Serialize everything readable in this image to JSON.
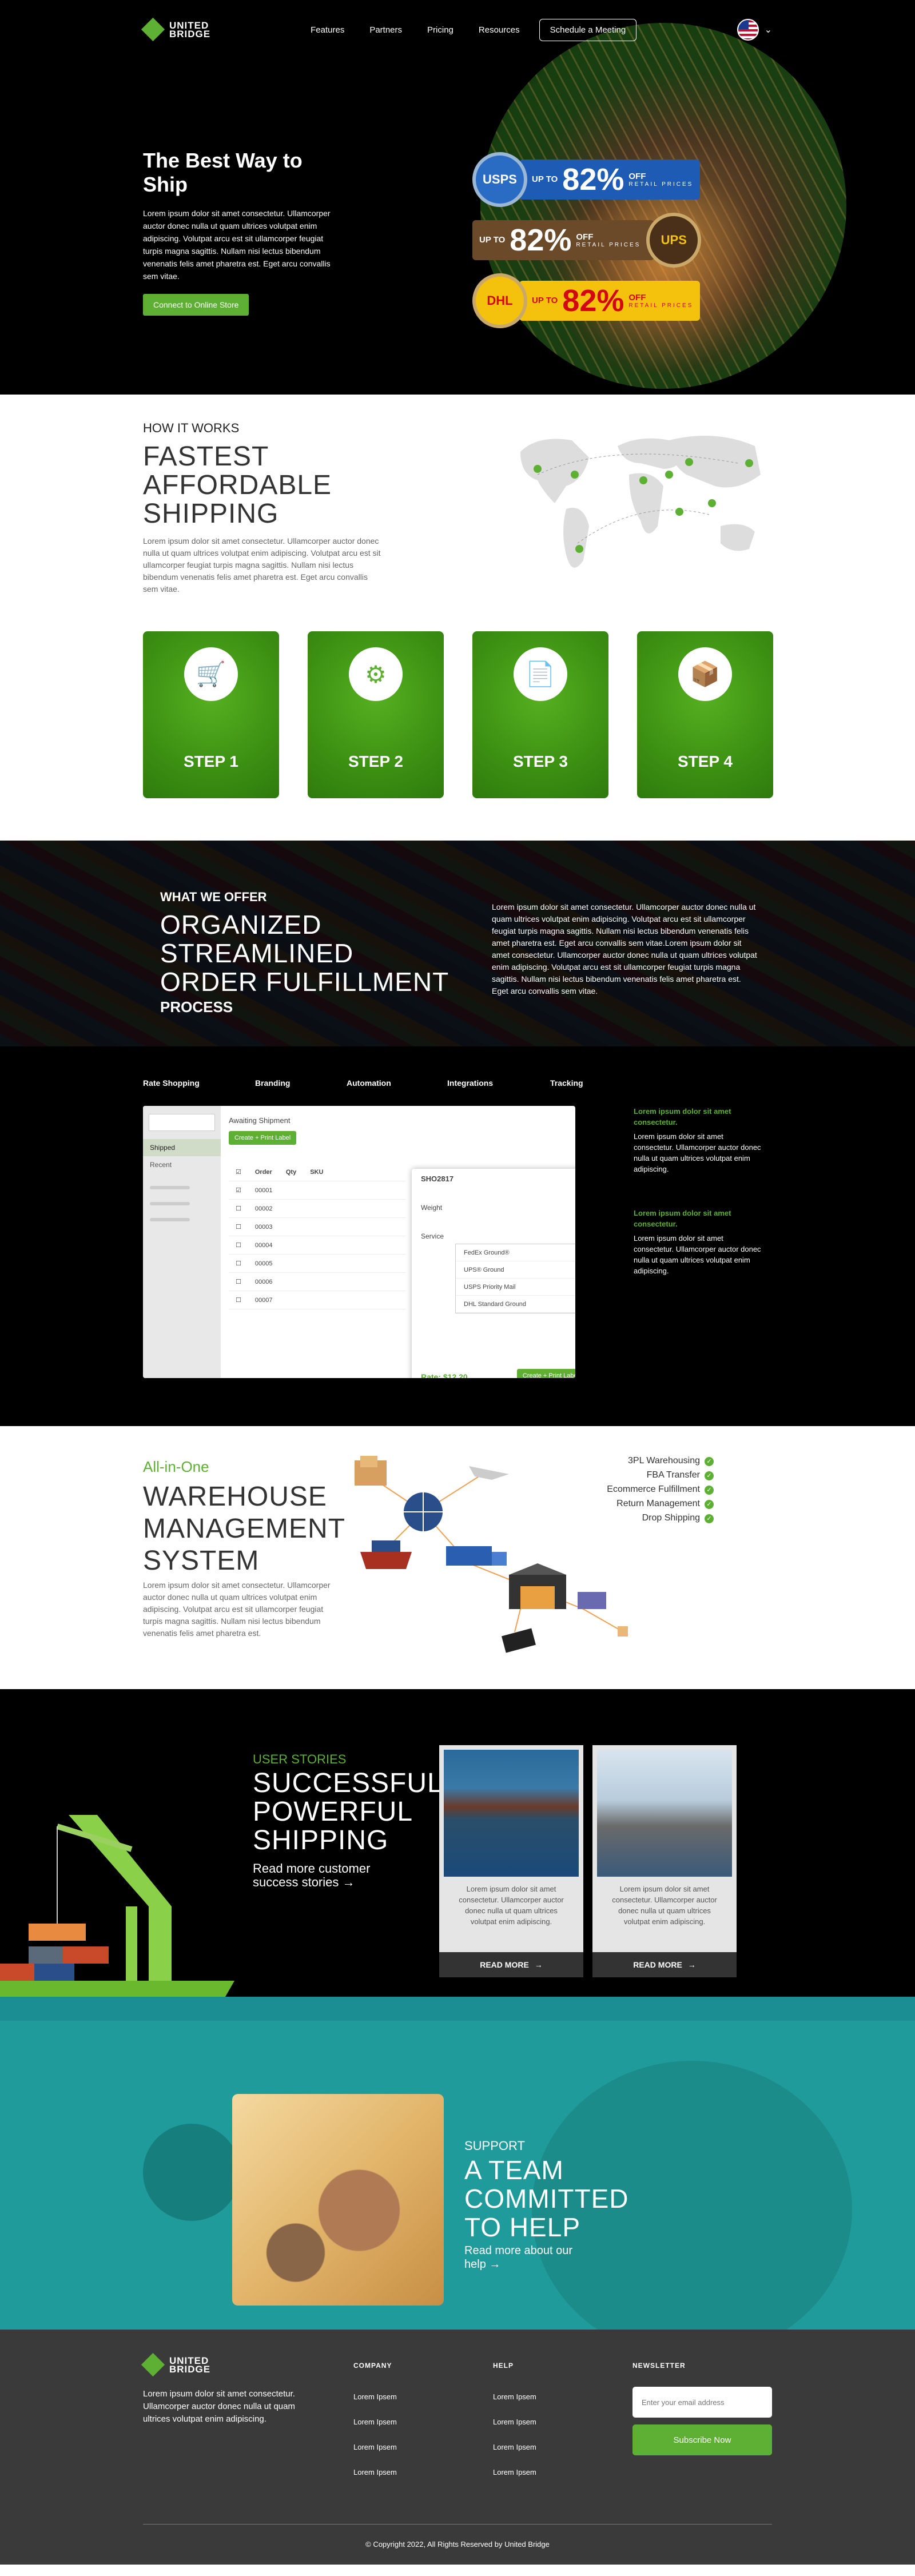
{
  "nav": {
    "brand_line1": "UNITED",
    "brand_line2": "BRIDGE",
    "items": [
      "Features",
      "Partners",
      "Pricing",
      "Resources"
    ],
    "cta": "Schedule a Meeting"
  },
  "hero": {
    "title": "The Best Way to Ship",
    "body": "Lorem ipsum dolor sit amet consectetur. Ullamcorper auctor donec nulla ut quam ultrices volutpat enim adipiscing. Volutpat arcu est sit ullamcorper feugiat turpis magna sagittis. Nullam nisi lectus bibendum venenatis felis amet pharetra est. Eget arcu convallis sem vitae.",
    "button": "Connect to Online Store",
    "badges": [
      {
        "carrier": "USPS",
        "upto": "UP TO",
        "pct": "82%",
        "off": "OFF",
        "retail": "RETAIL PRICES",
        "color": "#1d5bb5"
      },
      {
        "carrier": "UPS",
        "upto": "UP TO",
        "pct": "82%",
        "off": "OFF",
        "retail": "RETAIL PRICES",
        "color": "#6b4a2a"
      },
      {
        "carrier": "DHL",
        "upto": "UP TO",
        "pct": "82%",
        "off": "OFF",
        "retail": "RETAIL PRICES",
        "color": "#f4c20d"
      }
    ]
  },
  "how": {
    "kicker": "HOW IT WORKS",
    "title": "FASTEST AFFORDABLE SHIPPING",
    "body": "Lorem ipsum dolor sit amet consectetur. Ullamcorper auctor donec nulla ut quam ultrices volutpat enim adipiscing. Volutpat arcu est sit ullamcorper feugiat turpis magna sagittis. Nullam nisi lectus bibendum venenatis felis amet pharetra est. Eget arcu convallis sem vitae.",
    "steps": [
      "STEP 1",
      "STEP 2",
      "STEP 3",
      "STEP 4"
    ]
  },
  "offer": {
    "kicker": "WHAT WE OFFER",
    "title": "ORGANIZED STREAMLINED ORDER FULFILLMENT",
    "subtitle": "PROCESS",
    "body": "Lorem ipsum dolor sit amet consectetur. Ullamcorper auctor donec nulla ut quam ultrices volutpat enim adipiscing. Volutpat arcu est sit ullamcorper feugiat turpis magna sagittis. Nullam nisi lectus bibendum venenatis felis amet pharetra est. Eget arcu convallis sem vitae.Lorem ipsum dolor sit amet consectetur. Ullamcorper auctor donec nulla ut quam ultrices volutpat enim adipiscing. Volutpat arcu est sit ullamcorper feugiat turpis magna sagittis. Nullam nisi lectus bibendum venenatis felis amet pharetra est. Eget arcu convallis sem vitae."
  },
  "features": {
    "tabs": [
      "Rate Shopping",
      "Branding",
      "Automation",
      "Integrations",
      "Tracking"
    ],
    "mock": {
      "side_active": "Shipped",
      "side_item": "Recent",
      "header": "Awaiting Shipment",
      "pill": "Create + Print Label",
      "cols": [
        "Order",
        "Qty",
        "SKU"
      ],
      "rows": [
        "00001",
        "00002",
        "00003",
        "00004",
        "00005",
        "00006",
        "00007"
      ],
      "panel_title": "SHO2817",
      "weight_label": "Weight",
      "service_label": "Service",
      "options": [
        "FedEx Ground®",
        "UPS® Ground",
        "USPS Priority Mail",
        "DHL Standard Ground"
      ],
      "rate": "Rate: $12.20",
      "print": "Create + Print Label"
    },
    "side_items": [
      {
        "title": "Lorem ipsum dolor sit amet consectetur.",
        "body": "Lorem ipsum dolor sit amet consectetur. Ullamcorper auctor donec nulla ut quam ultrices volutpat enim adipiscing."
      },
      {
        "title": "Lorem ipsum dolor sit amet consectetur.",
        "body": "Lorem ipsum dolor sit amet consectetur. Ullamcorper auctor donec nulla ut quam ultrices volutpat enim adipiscing."
      }
    ]
  },
  "wms": {
    "kicker": "All-in-One",
    "title": "WAREHOUSE MANAGEMENT SYSTEM",
    "body": "Lorem ipsum dolor sit amet consectetur. Ullamcorper auctor donec nulla ut quam ultrices volutpat enim adipiscing. Volutpat arcu est sit ullamcorper feugiat turpis magna sagittis. Nullam nisi lectus bibendum venenatis felis amet pharetra est.",
    "list": [
      "3PL Warehousing",
      "FBA Transfer",
      "Ecommerce Fulfillment",
      "Return Management",
      "Drop Shipping"
    ]
  },
  "stories": {
    "kicker": "USER STORIES",
    "title": "SUCCESSFUL POWERFUL SHIPPING",
    "more": "Read more customer success stories →",
    "cards": [
      {
        "text": "Lorem ipsum dolor sit amet consectetur. Ullamcorper auctor donec nulla ut quam ultrices volutpat enim adipiscing.",
        "button": "READ MORE"
      },
      {
        "text": "Lorem ipsum dolor sit amet consectetur. Ullamcorper auctor donec nulla ut quam ultrices volutpat enim adipiscing.",
        "button": "READ MORE"
      }
    ]
  },
  "support": {
    "kicker": "SUPPORT",
    "title": "A TEAM COMMITTED TO HELP",
    "more": "Read more about our help →"
  },
  "footer": {
    "brand_line1": "UNITED",
    "brand_line2": "BRIDGE",
    "text": "Lorem ipsum dolor sit amet consectetur. Ullamcorper auctor donec nulla ut quam ultrices volutpat enim adipiscing.",
    "company_title": "COMPANY",
    "company": [
      "Lorem Ipsem",
      "Lorem Ipsem",
      "Lorem Ipsem",
      "Lorem Ipsem"
    ],
    "help_title": "HELP",
    "help": [
      "Lorem Ipsem",
      "Lorem Ipsem",
      "Lorem Ipsem",
      "Lorem Ipsem"
    ],
    "newsletter_title": "NEWSLETTER",
    "email_placeholder": "Enter your email address",
    "subscribe": "Subscribe Now",
    "copyright": "© Copyright 2022, All Rights Reserved by United Bridge"
  },
  "colors": {
    "accent": "#5db033",
    "teal": "#1e9b9a",
    "dark": "#3a3a3a"
  }
}
